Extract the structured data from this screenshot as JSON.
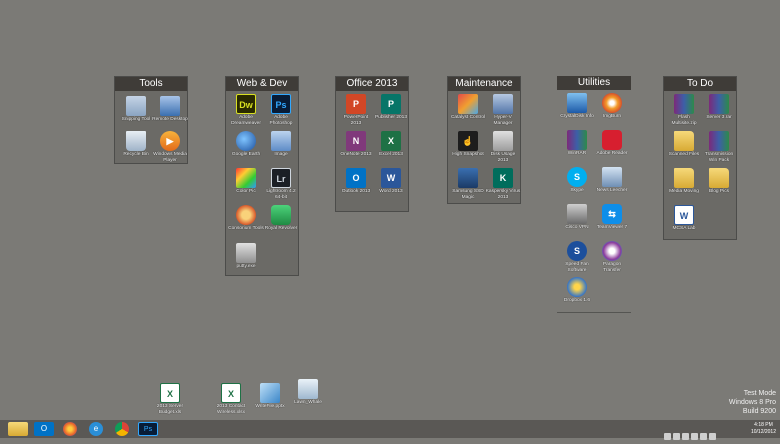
{
  "fences": [
    {
      "title": "Tools",
      "icons": [
        {
          "label": "Snipping Tool",
          "icon": "scissors-icon"
        },
        {
          "label": "Remote Desktop",
          "icon": "remote-desktop-icon"
        },
        {
          "label": "Recycle Bin",
          "icon": "recycle-bin-icon"
        },
        {
          "label": "Windows Media Player",
          "icon": "media-player-icon"
        }
      ]
    },
    {
      "title": "Web & Dev",
      "icons": [
        {
          "label": "Adobe Dreamweaver",
          "icon": "dreamweaver-icon",
          "text": "Dw"
        },
        {
          "label": "Adobe Photoshop",
          "icon": "photoshop-icon",
          "text": "Ps"
        },
        {
          "label": "Google Earth",
          "icon": "google-earth-icon"
        },
        {
          "label": "Image",
          "icon": "image-icon"
        },
        {
          "label": "Color Pic",
          "icon": "color-picker-icon"
        },
        {
          "label": "Lightroom 4.2 64-bit",
          "icon": "lightroom-icon",
          "text": "Lr"
        },
        {
          "label": "Consorium Tools",
          "icon": "pizza-icon"
        },
        {
          "label": "Royal Revolver",
          "icon": "robot-icon"
        },
        {
          "label": "putty.exe",
          "icon": "putty-icon"
        }
      ]
    },
    {
      "title": "Office 2013",
      "icons": [
        {
          "label": "PowerPoint 2013",
          "icon": "powerpoint-icon",
          "text": "P"
        },
        {
          "label": "Publisher 2013",
          "icon": "publisher-icon",
          "text": "P"
        },
        {
          "label": "OneNote 2013",
          "icon": "onenote-icon",
          "text": "N"
        },
        {
          "label": "Excel 2013",
          "icon": "excel-icon",
          "text": "X"
        },
        {
          "label": "Outlook 2013",
          "icon": "outlook-icon",
          "text": "O"
        },
        {
          "label": "Word 2013",
          "icon": "word-icon",
          "text": "W"
        }
      ]
    },
    {
      "title": "Maintenance",
      "icons": [
        {
          "label": "Catalyst Control",
          "icon": "catalyst-icon"
        },
        {
          "label": "Hyper-V Manager",
          "icon": "hyperv-icon"
        },
        {
          "label": "High Snapshot",
          "icon": "hand-icon"
        },
        {
          "label": "Disk Usage 2013",
          "icon": "disk-icon"
        },
        {
          "label": "Samsung SSD Magic",
          "icon": "ssd-icon"
        },
        {
          "label": "Kaspersky Virus 2013",
          "icon": "kaspersky-icon",
          "text": "K"
        }
      ]
    },
    {
      "title": "Utilities",
      "icons": [
        {
          "label": "CrystalDisk Info",
          "icon": "crystaldisk-icon"
        },
        {
          "label": "ImgBurn",
          "icon": "imgburn-icon"
        },
        {
          "label": "WinRAR",
          "icon": "winrar-icon"
        },
        {
          "label": "Adobe Reader",
          "icon": "adobe-reader-icon"
        },
        {
          "label": "Skype",
          "icon": "skype-icon",
          "text": "S"
        },
        {
          "label": "News Leecher",
          "icon": "newsleecher-icon"
        },
        {
          "label": "Cisco VPN",
          "icon": "vpn-icon"
        },
        {
          "label": "TeamViewer 7",
          "icon": "teamviewer-icon"
        },
        {
          "label": "Speed Fan Software",
          "icon": "speedfan-icon",
          "text": "S"
        },
        {
          "label": "Paragon Transfer",
          "icon": "paragon-icon"
        },
        {
          "label": "Dropbox 1.6",
          "icon": "dropbox-icon"
        }
      ]
    },
    {
      "title": "To Do",
      "icons": [
        {
          "label": "Flash Multisite.zip",
          "icon": "winrar-archive-icon"
        },
        {
          "label": "Server 3.rar",
          "icon": "winrar-archive-icon"
        },
        {
          "label": "Scanned Files",
          "icon": "folder-icon"
        },
        {
          "label": "Transmission Win Pack",
          "icon": "winrar-archive-icon"
        },
        {
          "label": "Media Moving",
          "icon": "folder-icon"
        },
        {
          "label": "Blog Pics",
          "icon": "folder-icon"
        },
        {
          "label": "MCSA Lab",
          "icon": "word-doc-icon",
          "text": "W"
        }
      ]
    }
  ],
  "desktop_icons": [
    {
      "label": "2013 Server Budget.xls",
      "icon": "excel-file-icon",
      "text": "X"
    },
    {
      "label": "2013 Contact Wireless.xlsx",
      "icon": "excel-file-icon",
      "text": "X"
    },
    {
      "label": "WriteFile.pptx",
      "icon": "document-icon"
    },
    {
      "label": "Lawn_Whale",
      "icon": "lawn-icon"
    }
  ],
  "taskbar": {
    "apps": [
      {
        "name": "file-explorer",
        "text": ""
      },
      {
        "name": "outlook",
        "text": "O"
      },
      {
        "name": "firefox",
        "text": ""
      },
      {
        "name": "internet-explorer",
        "text": "e"
      },
      {
        "name": "chrome",
        "text": ""
      },
      {
        "name": "photoshop",
        "text": "Ps"
      }
    ],
    "time": "4:18 PM",
    "date": "10/12/2012"
  },
  "watermark": {
    "line1": "Test Mode",
    "line2": "Windows 8 Pro",
    "line3": "Build 9200"
  },
  "colors": {
    "desktop_bg": "#7b7a76",
    "fence_title_bg": "#3f3c38",
    "powerpoint": "#d24726",
    "publisher": "#077568",
    "onenote": "#80397b",
    "excel": "#1e7145",
    "outlook": "#0072c6",
    "word": "#2b579a",
    "skype": "#00aff0",
    "kaspersky": "#006d5c"
  }
}
